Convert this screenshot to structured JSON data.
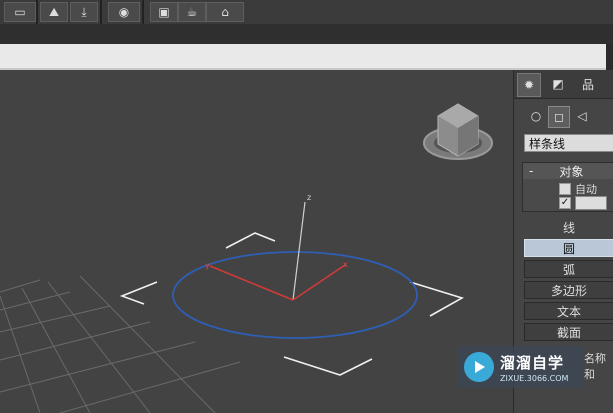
{
  "toolbar": {
    "buttons": [
      {
        "name": "select-region-icon"
      },
      {
        "name": "curve-editor-icon"
      },
      {
        "name": "render-setup-icon"
      },
      {
        "name": "material-editor-icon"
      },
      {
        "name": "render-frame-icon"
      },
      {
        "name": "teapot-render-icon"
      }
    ]
  },
  "panel": {
    "tabs": [
      {
        "name": "create-tab-icon",
        "active": true
      },
      {
        "name": "modify-tab-icon",
        "active": false
      },
      {
        "name": "hierarchy-tab-icon",
        "active": false
      }
    ],
    "subtabs": [
      {
        "name": "geometry-icon",
        "active": false
      },
      {
        "name": "shapes-icon",
        "active": true
      },
      {
        "name": "lights-icon",
        "active": false
      }
    ],
    "category_dropdown": "样条线",
    "rollout": {
      "collapse_symbol": "-",
      "title": "对象",
      "auto_grid_label": "自动",
      "auto_grid_checked": false,
      "start_new_shape_checked": true
    },
    "object_types": [
      {
        "label": "线",
        "active": false,
        "plain": true
      },
      {
        "label": "圆",
        "active": true,
        "plain": false
      },
      {
        "label": "弧",
        "active": false,
        "plain": false
      },
      {
        "label": "多边形",
        "active": false,
        "plain": false
      },
      {
        "label": "文本",
        "active": false,
        "plain": false
      },
      {
        "label": "截面",
        "active": false,
        "plain": false
      }
    ],
    "partial_label": "名称和"
  },
  "viewport": {
    "axis_labels": {
      "z": "z",
      "x": "x",
      "y": "y"
    },
    "circle_color": "#2e5fb5"
  },
  "watermark": {
    "brand": "溜溜自学",
    "url": "ZIXUE.3066.COM"
  }
}
